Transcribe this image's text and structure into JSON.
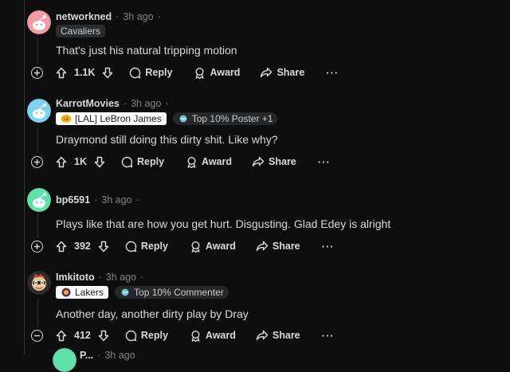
{
  "comments": [
    {
      "username": "networkned",
      "time": "3h ago",
      "flair": "Cavaliers",
      "badge": "",
      "text": "That's just his natural tripping motion",
      "score": "1.1K",
      "avatar_color": "#f29ca6",
      "collapse": "expand"
    },
    {
      "username": "KarrotMovies",
      "time": "3h ago",
      "flair": "[LAL] LeBron James",
      "badge": "Top 10% Poster +1",
      "text": "Draymond still doing this dirty shit. Like why?",
      "score": "1K",
      "avatar_color": "#7cd4f0",
      "collapse": "expand"
    },
    {
      "username": "bp6591",
      "time": "3h ago",
      "flair": "",
      "badge": "",
      "text": "Plays like that are how you get hurt. Disgusting. Glad Edey is alright",
      "score": "392",
      "avatar_color": "#5fe0a8",
      "collapse": "expand"
    },
    {
      "username": "Imkitoto",
      "time": "3h ago",
      "flair": "Lakers",
      "badge": "Top 10% Commenter",
      "text": "Another day, another dirty play by Dray",
      "score": "412",
      "avatar_color": "#2b2b2b",
      "collapse": "collapse"
    }
  ],
  "actions": {
    "reply": "Reply",
    "award": "Award",
    "share": "Share",
    "more": "···"
  },
  "partial_next": {
    "username": "P...",
    "time": "3h ago"
  },
  "colors": {
    "background": "#0e0e0f",
    "text": "#d7dadc",
    "muted": "#818384",
    "flair_grey": "#2b2d2f",
    "thread_line": "#343536"
  }
}
